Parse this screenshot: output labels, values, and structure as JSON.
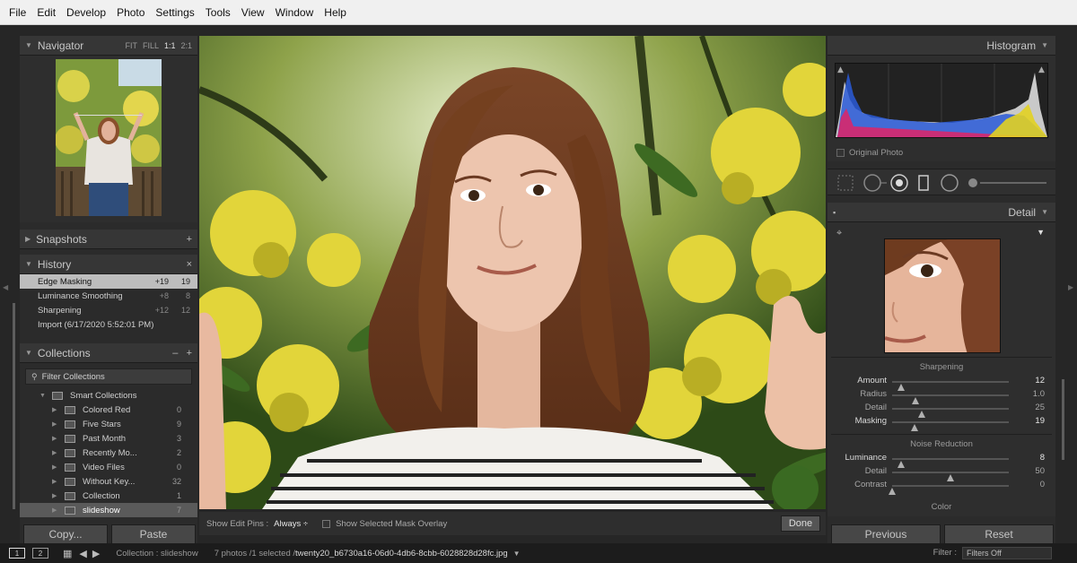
{
  "menu": [
    "File",
    "Edit",
    "Develop",
    "Photo",
    "Settings",
    "Tools",
    "View",
    "Window",
    "Help"
  ],
  "navigator": {
    "title": "Navigator",
    "zoom_options": [
      "FIT",
      "FILL",
      "1:1",
      "2:1"
    ],
    "zoom_selected": "1:1"
  },
  "snapshots": {
    "title": "Snapshots",
    "action": "+"
  },
  "history": {
    "title": "History",
    "action": "×",
    "items": [
      {
        "label": "Edge Masking",
        "a": "+19",
        "b": "19",
        "selected": true
      },
      {
        "label": "Luminance Smoothing",
        "a": "+8",
        "b": "8",
        "selected": false
      },
      {
        "label": "Sharpening",
        "a": "+12",
        "b": "12",
        "selected": false
      },
      {
        "label": "Import (6/17/2020 5:52:01 PM)",
        "a": "",
        "b": "",
        "selected": false
      }
    ]
  },
  "collections": {
    "title": "Collections",
    "actions": [
      "–",
      "+"
    ],
    "filter_placeholder": "Filter Collections",
    "items": [
      {
        "label": "Smart Collections",
        "count": "",
        "level": 1,
        "expanded": true
      },
      {
        "label": "Colored Red",
        "count": "0",
        "level": 2
      },
      {
        "label": "Five Stars",
        "count": "9",
        "level": 2
      },
      {
        "label": "Past Month",
        "count": "3",
        "level": 2
      },
      {
        "label": "Recently Mo...",
        "count": "2",
        "level": 2
      },
      {
        "label": "Video Files",
        "count": "0",
        "level": 2
      },
      {
        "label": "Without Key...",
        "count": "32",
        "level": 2
      },
      {
        "label": "Collection",
        "count": "1",
        "level": 2
      },
      {
        "label": "slideshow",
        "count": "7",
        "level": 2,
        "selected": true
      }
    ]
  },
  "left_buttons": {
    "copy": "Copy...",
    "paste": "Paste"
  },
  "toolbar": {
    "show_edit_pins_label": "Show Edit Pins :",
    "show_edit_pins_value": "Always ÷",
    "mask_overlay_label": "Show Selected Mask Overlay",
    "done_label": "Done"
  },
  "histogram": {
    "title": "Histogram",
    "original_photo_label": "Original Photo"
  },
  "detail": {
    "title": "Detail",
    "sharpening_title": "Sharpening",
    "sharpening": [
      {
        "label": "Amount",
        "value": "12",
        "fraction": 0.08,
        "bright": true
      },
      {
        "label": "Radius",
        "value": "1.0",
        "fraction": 0.2,
        "bright": false
      },
      {
        "label": "Detail",
        "value": "25",
        "fraction": 0.25,
        "bright": false
      },
      {
        "label": "Masking",
        "value": "19",
        "fraction": 0.19,
        "bright": true
      }
    ],
    "noise_title": "Noise Reduction",
    "noise": [
      {
        "label": "Luminance",
        "value": "8",
        "fraction": 0.08,
        "bright": true
      },
      {
        "label": "Detail",
        "value": "50",
        "fraction": 0.5,
        "bright": false
      },
      {
        "label": "Contrast",
        "value": "0",
        "fraction": 0.0,
        "bright": false
      }
    ],
    "color_label": "Color"
  },
  "right_buttons": {
    "previous": "Previous",
    "reset": "Reset"
  },
  "filmstrip": {
    "screen1": "1",
    "screen2": "2",
    "collection": "Collection : slideshow",
    "count": "7 photos /1 selected /",
    "filename": "twenty20_b6730a16-06d0-4db6-8cbb-6028828d28fc.jpg",
    "filter_label": "Filter :",
    "filter_value": "Filters Off"
  }
}
